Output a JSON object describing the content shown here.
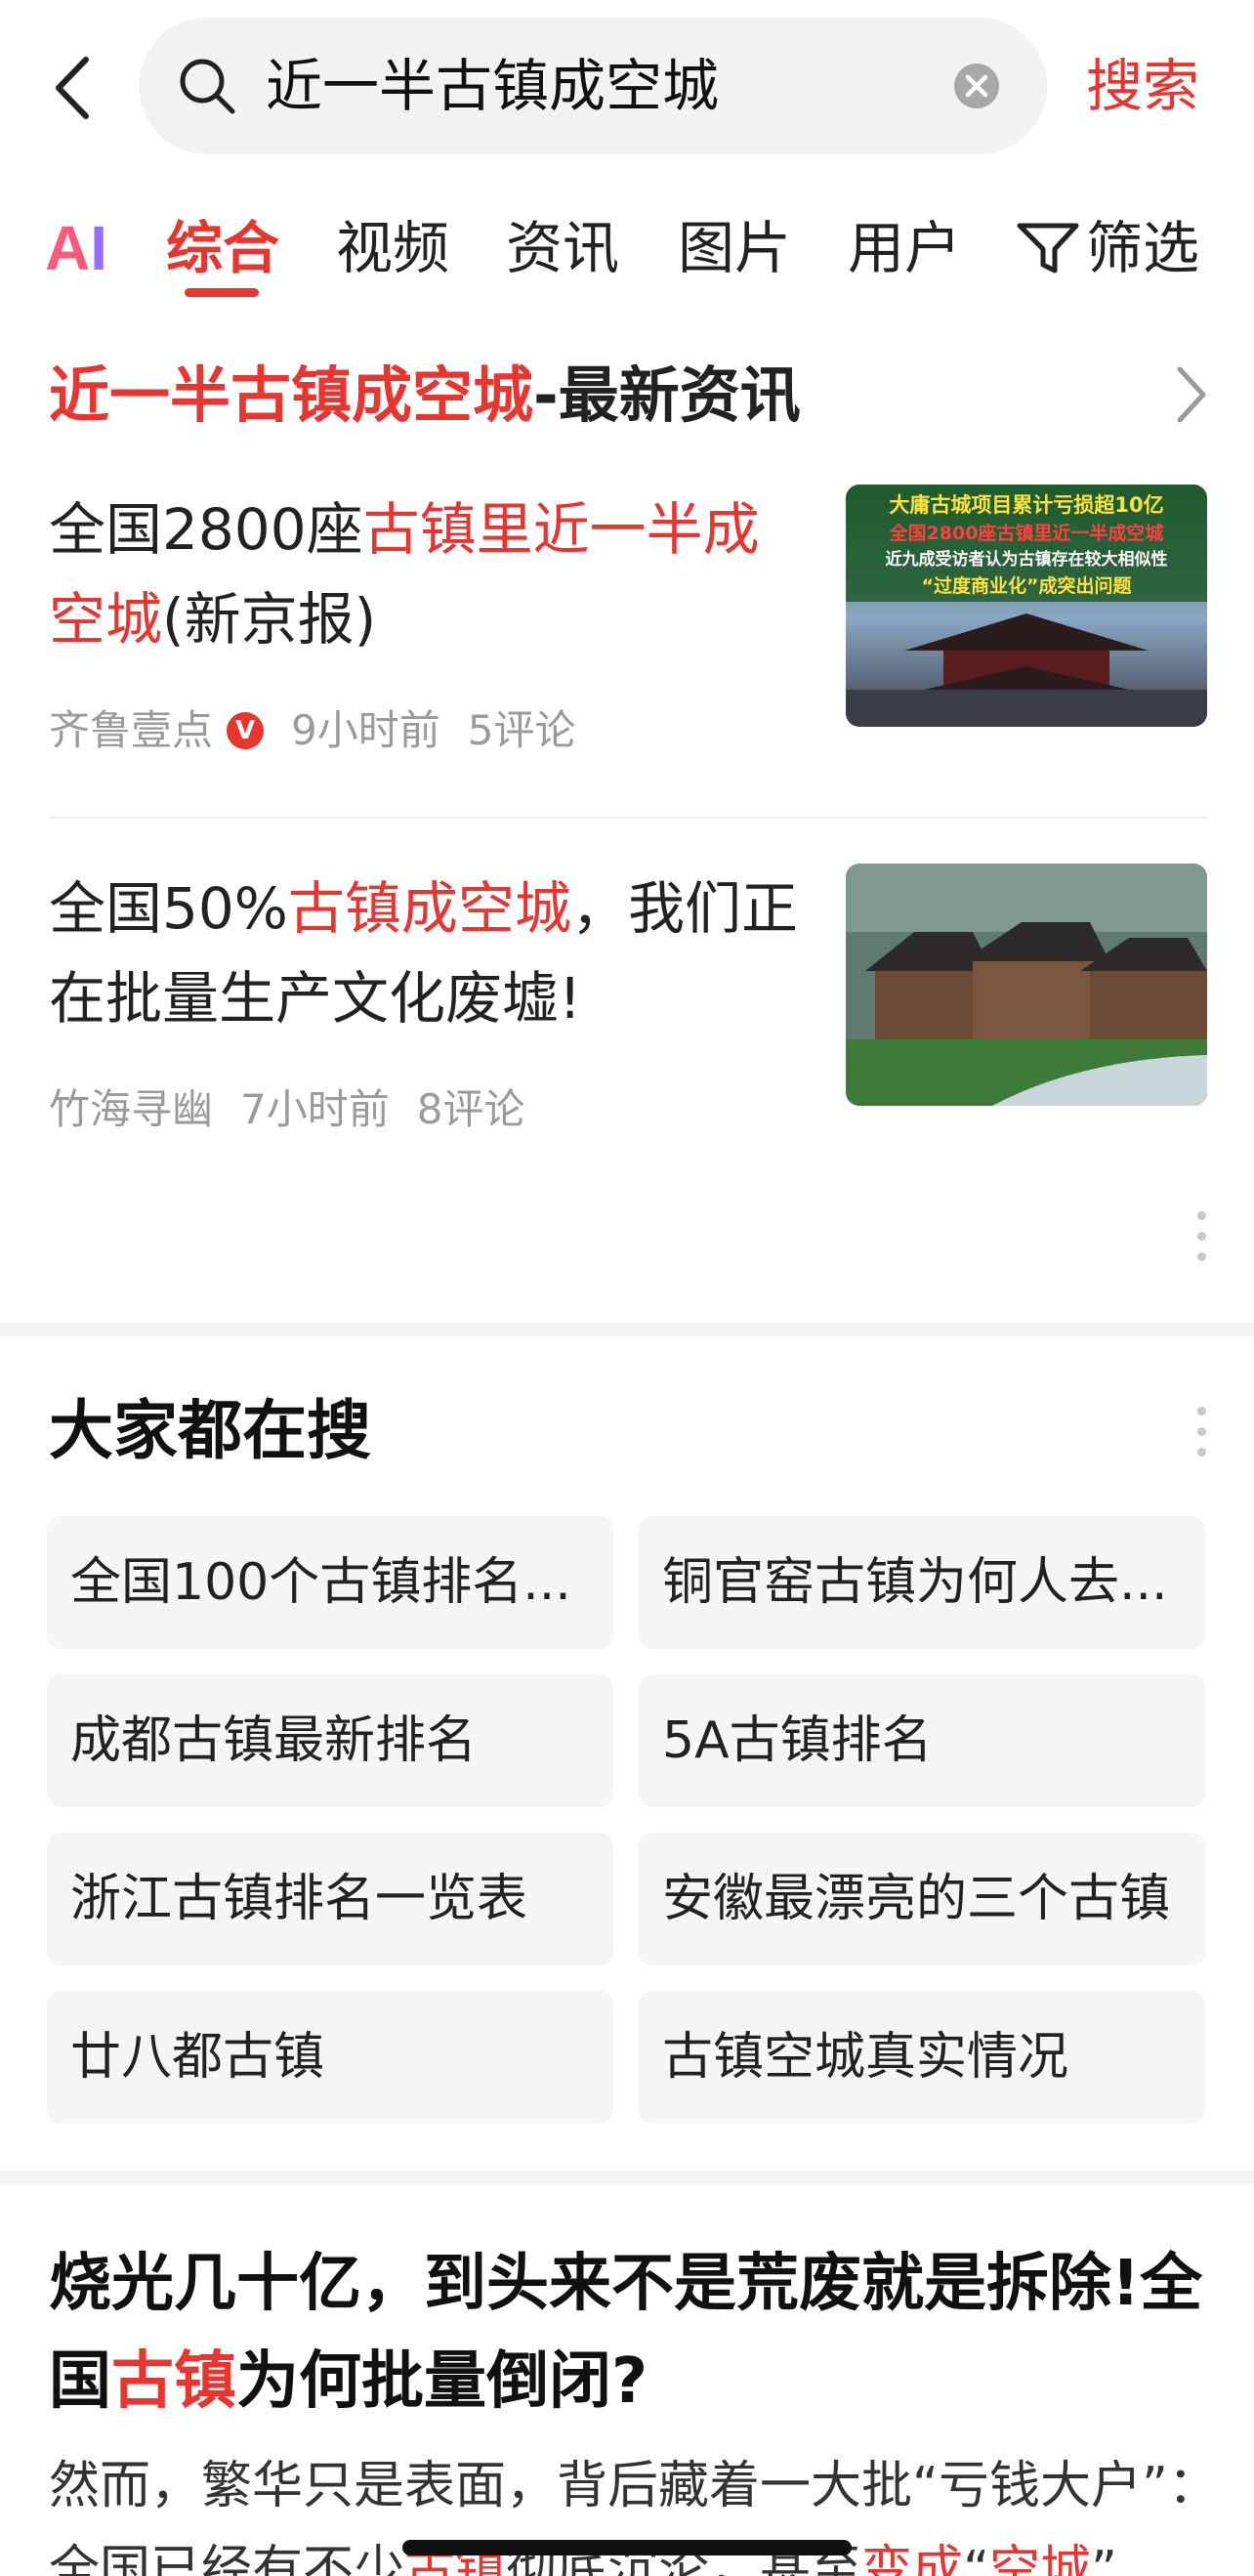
{
  "search": {
    "query": "近一半古镇成空城",
    "submit_label": "搜索"
  },
  "tabs": {
    "ai": {
      "a": "A",
      "i": "I"
    },
    "items": [
      "综合",
      "视频",
      "资讯",
      "图片",
      "用户"
    ],
    "active": "综合",
    "filter_label": "筛选"
  },
  "news": {
    "header_keyword": "近一半古镇成空城",
    "header_suffix": "-最新资讯",
    "articles": [
      {
        "title_parts": [
          "全国2800座",
          "古镇里近一半成空城",
          "(新京报)"
        ],
        "source": "齐鲁壹点",
        "verified_badge": "V",
        "time": "9小时前",
        "comments": "5评论",
        "thumb_lines": [
          "大庸古城项目累计亏损超10亿",
          "全国2800座古镇里近一半成空城",
          "近九成受访者认为古镇存在较大相似性",
          "“过度商业化”成突出问题"
        ]
      },
      {
        "title_parts": [
          "全国50%",
          "古镇成空城",
          "，我们正在批量生产文化废墟!"
        ],
        "source": "竹海寻幽",
        "time": "7小时前",
        "comments": "8评论"
      }
    ]
  },
  "hot_searches": {
    "title": "大家都在搜",
    "items": [
      "全国100个古镇排名...",
      "铜官窑古镇为何人去...",
      "成都古镇最新排名",
      "5A古镇排名",
      "浙江古镇排名一览表",
      "安徽最漂亮的三个古镇",
      "廿八都古镇",
      "古镇空城真实情况"
    ]
  },
  "bottom_article": {
    "title_parts": [
      "烧光几十亿，到头来不是荒废就是拆除!全国",
      "古镇",
      "为何批量倒闭?"
    ],
    "excerpt_parts": [
      "然而，繁华只是表面，背后藏着一大批“亏钱大户”：全国已经有不少",
      "古镇",
      "彻底沉沦，甚至",
      "变成",
      "“",
      "空城",
      "”"
    ]
  },
  "colors": {
    "accent": "#e8352f",
    "meta_gray": "#9a9a9a",
    "chip_bg": "#f5f5f5"
  }
}
